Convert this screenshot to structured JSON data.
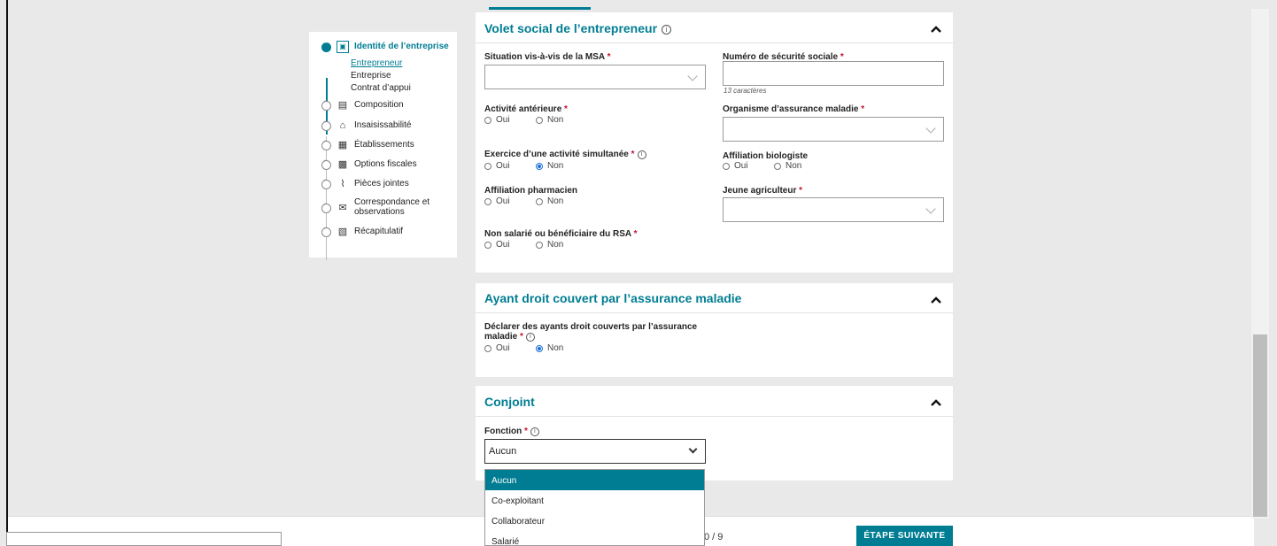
{
  "stepper": {
    "steps": [
      {
        "label": "Identité de l’entreprise",
        "icon": "id-card-icon",
        "active": true
      },
      {
        "label": "Composition",
        "icon": "composition-icon"
      },
      {
        "label": "Insaisissabilité",
        "icon": "house-icon"
      },
      {
        "label": "Établissements",
        "icon": "building-icon"
      },
      {
        "label": "Options fiscales",
        "icon": "calculator-icon"
      },
      {
        "label": "Pièces jointes",
        "icon": "paperclip-icon"
      },
      {
        "label": "Correspondance et observations",
        "icon": "correspondence-icon"
      },
      {
        "label": "Récapitulatif",
        "icon": "summary-icon"
      }
    ],
    "substeps": [
      "Entrepreneur",
      "Entreprise",
      "Contrat d’appui"
    ]
  },
  "volet_social": {
    "title": "Volet social de l’entrepreneur",
    "msa_label": "Situation vis-à-vis de la MSA",
    "secu_label": "Numéro de sécurité sociale",
    "secu_hint": "13 caractères",
    "activite_label": "Activité antérieure",
    "organisme_label": "Organisme d’assurance maladie",
    "exercice_label": "Exercice d’une activité simultanée",
    "biologiste_label": "Affiliation biologiste",
    "pharmacien_label": "Affiliation pharmacien",
    "jeune_label": "Jeune agriculteur",
    "rsa_label": "Non salarié ou bénéficiaire du RSA",
    "oui": "Oui",
    "non": "Non",
    "required": "*"
  },
  "ayant_droit": {
    "title": "Ayant droit couvert par l’assurance maladie",
    "label_line1": "Déclarer des ayants droit couverts par l’assurance",
    "label_line2": "maladie"
  },
  "conjoint": {
    "title": "Conjoint",
    "fonction_label": "Fonction",
    "fonction_value": "Aucun",
    "options": [
      "Aucun",
      "Co-exploitant",
      "Collaborateur",
      "Salarié"
    ]
  },
  "footer": {
    "pager": "0 / 9",
    "next_button": "ÉTAPE SUIVANTE"
  },
  "colors": {
    "accent": "#007d93",
    "required": "#c8102e"
  }
}
